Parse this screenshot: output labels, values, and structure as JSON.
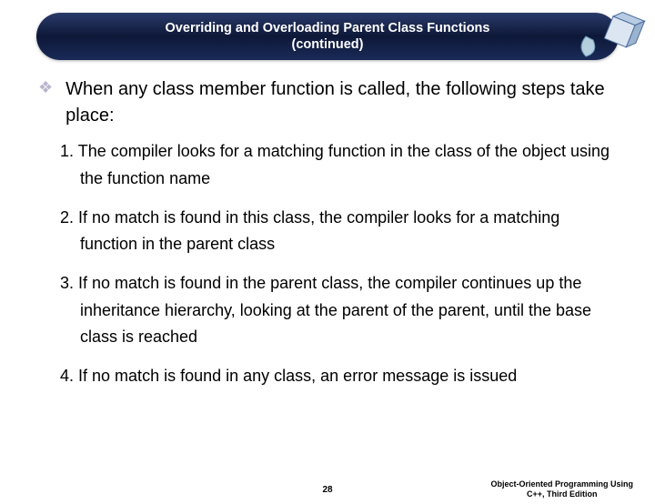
{
  "title": {
    "line1": "Overriding and Overloading Parent Class Functions",
    "line2": "(continued)"
  },
  "intro": "When any class member function is called, the following steps take place:",
  "steps": [
    "The compiler looks for a matching function in the class of the object using the function name",
    "If no match is found in this class, the compiler looks for a matching function in the parent class",
    "If no match is found in the parent class, the compiler continues up the inheritance hierarchy, looking at the parent of the parent, until the base class is reached",
    "If no match is found in any class, an error message is issued"
  ],
  "numbers": {
    "s1": "1.",
    "s2": "2.",
    "s3": "3.",
    "s4": "4."
  },
  "footer": {
    "page": "28",
    "credit_line1": "Object-Oriented Programming Using",
    "credit_line2": "C++, Third Edition"
  }
}
